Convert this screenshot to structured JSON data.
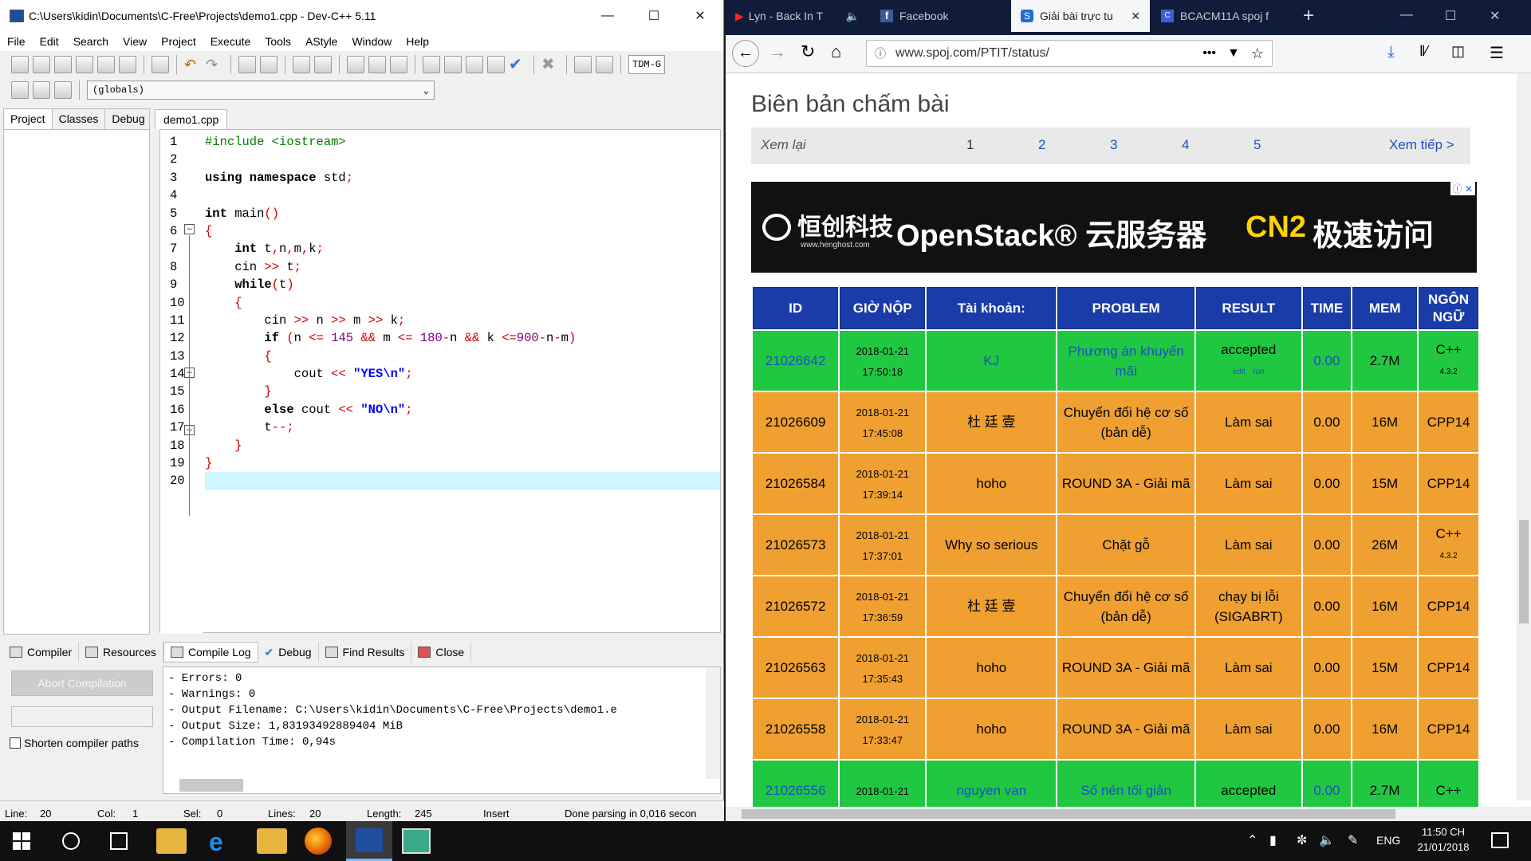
{
  "devcpp": {
    "title": "C:\\Users\\kidin\\Documents\\C-Free\\Projects\\demo1.cpp - Dev-C++ 5.11",
    "menu": [
      "File",
      "Edit",
      "Search",
      "View",
      "Project",
      "Execute",
      "Tools",
      "AStyle",
      "Window",
      "Help"
    ],
    "compiler_set": "TDM-G",
    "scope": "(globals)",
    "left_tabs": [
      "Project",
      "Classes",
      "Debug"
    ],
    "file_tab": "demo1.cpp",
    "line_numbers": [
      "1",
      "2",
      "3",
      "4",
      "5",
      "6",
      "7",
      "8",
      "9",
      "10",
      "11",
      "12",
      "13",
      "14",
      "15",
      "16",
      "17",
      "18",
      "19",
      "20"
    ],
    "bottom_tabs": [
      "Compiler",
      "Resources",
      "Compile Log",
      "Debug",
      "Find Results",
      "Close"
    ],
    "abort_button": "Abort Compilation",
    "shorten_paths": "Shorten compiler paths",
    "log": [
      "- Errors: 0",
      "- Warnings: 0",
      "- Output Filename: C:\\Users\\kidin\\Documents\\C-Free\\Projects\\demo1.e",
      "- Output Size: 1,83193492889404 MiB",
      "- Compilation Time: 0,94s"
    ],
    "status": {
      "line": "Line:",
      "line_v": "20",
      "col": "Col:",
      "col_v": "1",
      "sel": "Sel:",
      "sel_v": "0",
      "lines": "Lines:",
      "lines_v": "20",
      "length": "Length:",
      "length_v": "245",
      "mode": "Insert",
      "parse": "Done parsing in 0,016 secon"
    }
  },
  "firefox": {
    "tabs": [
      "Lyn - Back In T",
      "Facebook",
      "Giải bài trực tu",
      "BCACM11A spoj f"
    ],
    "url": "www.spoj.com/PTIT/status/",
    "heading": "Biên bản chấm bài",
    "pager": {
      "prev": "Xem lại",
      "pages": [
        "1",
        "2",
        "3",
        "4",
        "5"
      ],
      "next": "Xem tiếp >"
    },
    "ad": {
      "brand": "恒创科技",
      "site": "www.henghost.com",
      "text1": "OpenStack® 云服务器",
      "text2a": "CN2",
      "text2b": "极速访问"
    },
    "columns": [
      "ID",
      "GIỜ NỘP",
      "Tài khoản:",
      "PROBLEM",
      "RESULT",
      "TIME",
      "MEM",
      "NGÔN NGỮ"
    ],
    "rows": [
      {
        "id": "21026642",
        "date": "2018-01-21",
        "time": "17:50:18",
        "user": "KJ",
        "problem": "Phương án khuyến mãi",
        "result": "accepted",
        "sub1": "edit",
        "sub2": "run",
        "t": "0.00",
        "mem": "2.7M",
        "lang": "C++",
        "langv": "4.3.2",
        "color": "#20c841"
      },
      {
        "id": "21026609",
        "date": "2018-01-21",
        "time": "17:45:08",
        "user": "杜 廷 壹",
        "problem": "Chuyển đổi hệ cơ số (bản dễ)",
        "result": "Làm sai",
        "t": "0.00",
        "mem": "16M",
        "lang": "CPP14",
        "color": "#f0a030"
      },
      {
        "id": "21026584",
        "date": "2018-01-21",
        "time": "17:39:14",
        "user": "hoho",
        "problem": "ROUND 3A - Giải mã",
        "result": "Làm sai",
        "t": "0.00",
        "mem": "15M",
        "lang": "CPP14",
        "color": "#f0a030"
      },
      {
        "id": "21026573",
        "date": "2018-01-21",
        "time": "17:37:01",
        "user": "Why so serious",
        "problem": "Chặt gỗ",
        "result": "Làm sai",
        "t": "0.00",
        "mem": "26M",
        "lang": "C++",
        "langv": "4.3.2",
        "color": "#f0a030"
      },
      {
        "id": "21026572",
        "date": "2018-01-21",
        "time": "17:36:59",
        "user": "杜 廷 壹",
        "problem": "Chuyển đổi hệ cơ số (bản dễ)",
        "result": "chạy bị lỗi (SIGABRT)",
        "t": "0.00",
        "mem": "16M",
        "lang": "CPP14",
        "color": "#f0a030"
      },
      {
        "id": "21026563",
        "date": "2018-01-21",
        "time": "17:35:43",
        "user": "hoho",
        "problem": "ROUND 3A - Giải mã",
        "result": "Làm sai",
        "t": "0.00",
        "mem": "15M",
        "lang": "CPP14",
        "color": "#f0a030"
      },
      {
        "id": "21026558",
        "date": "2018-01-21",
        "time": "17:33:47",
        "user": "hoho",
        "problem": "ROUND 3A - Giải mã",
        "result": "Làm sai",
        "t": "0.00",
        "mem": "16M",
        "lang": "CPP14",
        "color": "#f0a030"
      },
      {
        "id": "21026556",
        "date": "2018-01-21",
        "time": "",
        "user": "nguyen van",
        "problem": "Số nén tối giản",
        "result": "accepted",
        "t": "0.00",
        "mem": "2.7M",
        "lang": "C++",
        "color": "#20c841"
      }
    ]
  },
  "taskbar": {
    "lang": "ENG",
    "time": "11:50 CH",
    "date": "21/01/2018"
  }
}
